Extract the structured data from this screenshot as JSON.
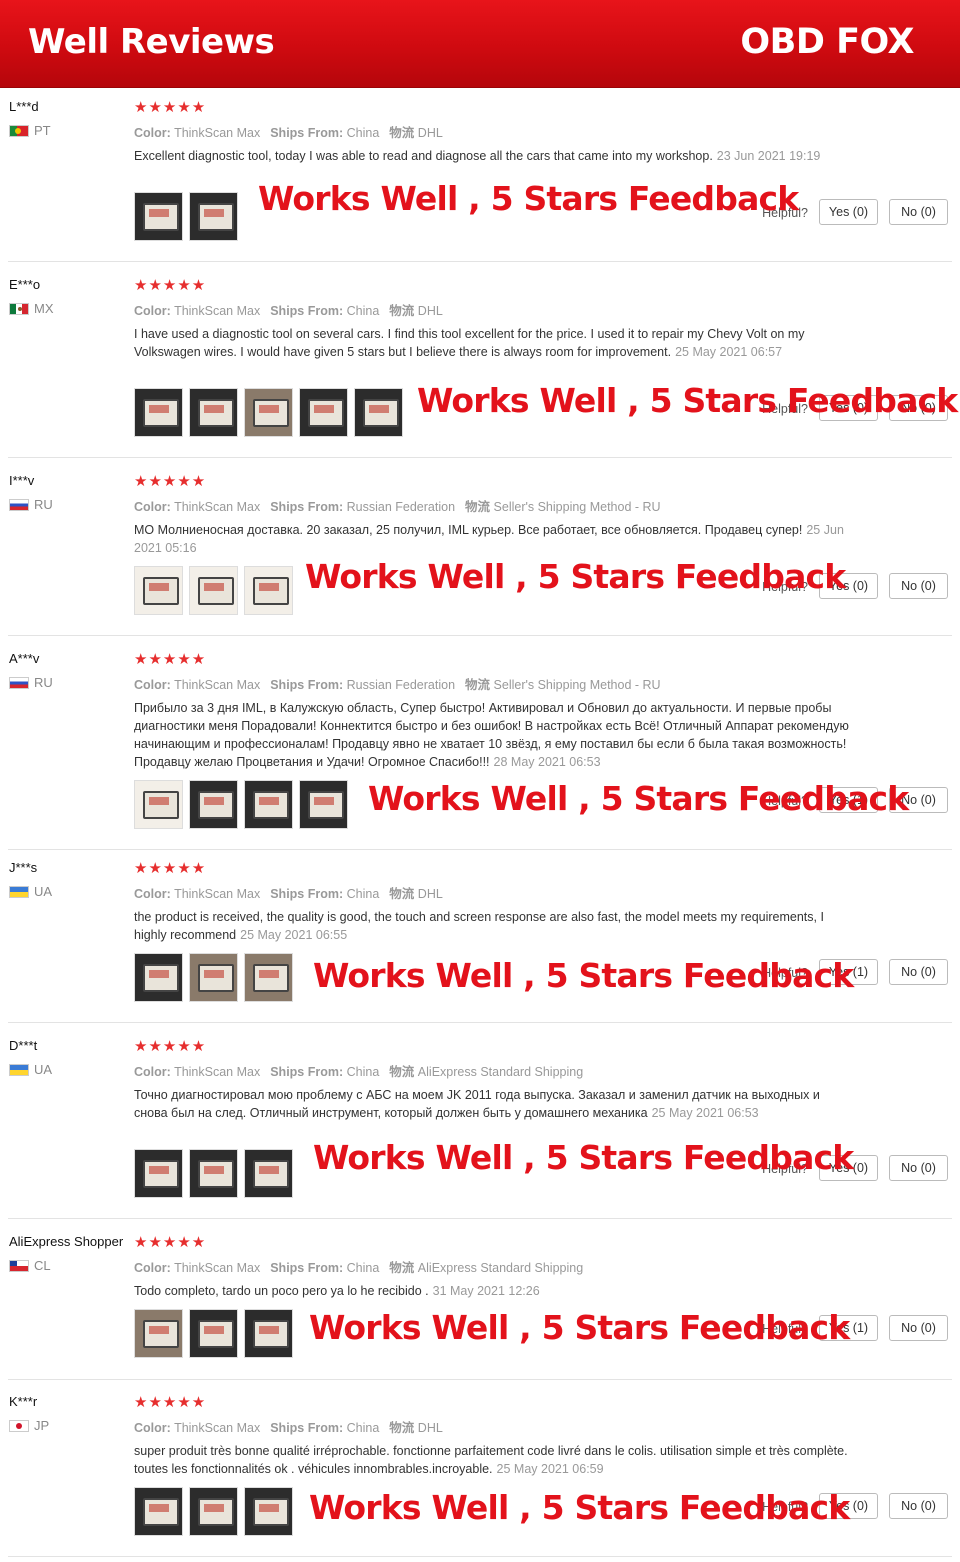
{
  "banner": {
    "title": "Well Reviews",
    "brand": "OBD FOX"
  },
  "labels": {
    "color_label": "Color:",
    "ships_label": "Ships From:",
    "method_label": "物流",
    "helpful": "Helpful?",
    "stars": "★★★★★",
    "overlay": "Works Well , 5 Stars Feedback"
  },
  "colors": {
    "banner_red": "#d10c12",
    "star_red": "#e62e2e",
    "overlay_red": "#e3121b"
  },
  "reviews": [
    {
      "user": "L***d",
      "country": "PT",
      "flag": "pt-flag",
      "rating": 5,
      "color": "ThinkScan Max",
      "ships_from": "China",
      "method": "DHL",
      "text": "Excellent diagnostic tool, today I was able to read and diagnose all the cars that came into my workshop.",
      "date": "23 Jun 2021 19:19",
      "yes": "Yes (0)",
      "no": "No (0)",
      "photos": 2
    },
    {
      "user": "E***o",
      "country": "MX",
      "flag": "mx-flag",
      "rating": 5,
      "color": "ThinkScan Max",
      "ships_from": "China",
      "method": "DHL",
      "text": "I have used a diagnostic tool on several cars. I find this tool excellent for the price. I used it to repair my Chevy Volt on my Volkswagen wires. I would have given 5 stars but I believe there is always room for improvement.",
      "date": "25 May 2021 06:57",
      "yes": "Yes (0)",
      "no": "No (0)",
      "photos": 5
    },
    {
      "user": "I***v",
      "country": "RU",
      "flag": "ru-flag",
      "rating": 5,
      "color": "ThinkScan Max",
      "ships_from": "Russian Federation",
      "method": "Seller's Shipping Method - RU",
      "text": "МО Молниеносная доставка. 20 заказал, 25 получил, IML курьер. Все работает, все обновляется. Продавец супер!",
      "date": "25 Jun 2021 05:16",
      "yes": "Yes (0)",
      "no": "No (0)",
      "photos": 3
    },
    {
      "user": "A***v",
      "country": "RU",
      "flag": "ru-flag",
      "rating": 5,
      "color": "ThinkScan Max",
      "ships_from": "Russian Federation",
      "method": "Seller's Shipping Method - RU",
      "text": "Прибыло за 3 дня IML, в Калужскую область, Супер быстро! Активировал и Обновил до актуальности. И первые пробы диагностики меня Порадовали! Коннектится быстро и без ошибок! В настройках есть Всё! Отличный Аппарат рекомендую начинающим и профессионалам! Продавцу явно не хватает 10 звёзд, я ему поставил бы если б была такая возможность! Продавцу желаю Процветания и Удачи! Огромное Спасибо!!!",
      "date": "28 May 2021 06:53",
      "yes": "Yes (1)",
      "no": "No (0)",
      "photos": 4
    },
    {
      "user": "J***s",
      "country": "UA",
      "flag": "ua-flag",
      "rating": 5,
      "color": "ThinkScan Max",
      "ships_from": "China",
      "method": "DHL",
      "text": "the product is received, the quality is good, the touch and screen response are also fast, the model meets my requirements, I highly recommend",
      "date": "25 May 2021 06:55",
      "yes": "Yes (1)",
      "no": "No (0)",
      "photos": 3
    },
    {
      "user": "D***t",
      "country": "UA",
      "flag": "ua-flag",
      "rating": 5,
      "color": "ThinkScan Max",
      "ships_from": "China",
      "method": "AliExpress Standard Shipping",
      "text": "Точно диагностировал мою проблему с АБС на моем JK 2011 года выпуска. Заказал и заменил датчик на выходных и снова был на след. Отличный инструмент, который должен быть у домашнего механика",
      "date": "25 May 2021 06:53",
      "yes": "Yes (0)",
      "no": "No (0)",
      "photos": 3
    },
    {
      "user": "AliExpress Shopper",
      "country": "CL",
      "flag": "cl-flag",
      "rating": 5,
      "color": "ThinkScan Max",
      "ships_from": "China",
      "method": "AliExpress Standard Shipping",
      "text": "Todo completo, tardo un poco pero ya lo he recibido .",
      "date": "31 May 2021 12:26",
      "yes": "Yes (1)",
      "no": "No (0)",
      "photos": 3
    },
    {
      "user": "K***r",
      "country": "JP",
      "flag": "jp-flag",
      "rating": 5,
      "color": "ThinkScan Max",
      "ships_from": "China",
      "method": "DHL",
      "text": "super produit très bonne qualité irréprochable. fonctionne parfaitement code livré dans le colis. utilisation simple et très complète. toutes les fonctionnalités ok . véhicules innombrables.incroyable.",
      "date": "25 May 2021 06:59",
      "yes": "Yes (0)",
      "no": "No (0)",
      "photos": 3
    }
  ]
}
